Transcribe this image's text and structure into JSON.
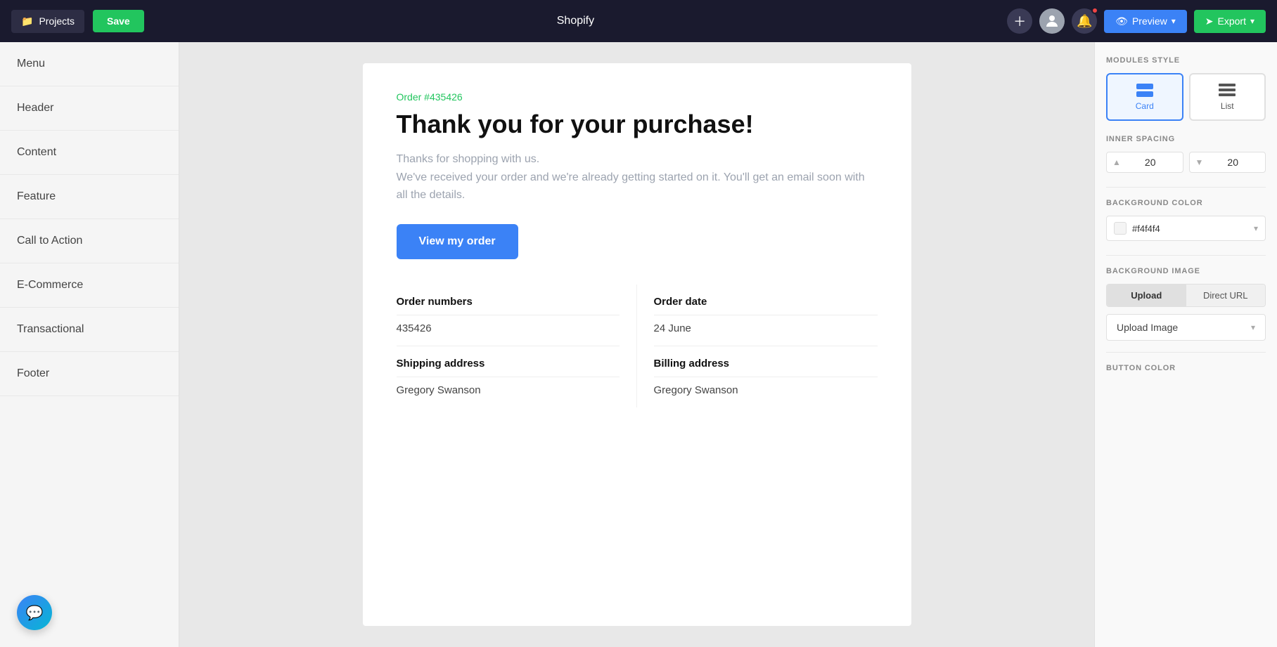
{
  "topbar": {
    "projects_label": "Projects",
    "save_label": "Save",
    "title": "Shopify",
    "preview_label": "Preview",
    "export_label": "Export"
  },
  "sidebar": {
    "items": [
      {
        "label": "Menu"
      },
      {
        "label": "Header"
      },
      {
        "label": "Content"
      },
      {
        "label": "Feature"
      },
      {
        "label": "Call to Action"
      },
      {
        "label": "E-Commerce"
      },
      {
        "label": "Transactional"
      },
      {
        "label": "Footer"
      }
    ]
  },
  "email": {
    "order_label": "Order #435426",
    "title": "Thank you for your purchase!",
    "body_line1": "Thanks for shopping with us.",
    "body_line2": "We've received your order and we're already getting started on it. You'll get an email soon with all the details.",
    "cta_button": "View my order",
    "col1_label1": "Order numbers",
    "col1_value1": "435426",
    "col1_label2": "Shipping address",
    "col1_value2": "Gregory Swanson",
    "col2_label1": "Order date",
    "col2_value1": "24 June",
    "col2_label2": "Billing address",
    "col2_value2": "Gregory Swanson"
  },
  "right_panel": {
    "modules_style_title": "MODULES STYLE",
    "card_label": "Card",
    "list_label": "List",
    "inner_spacing_title": "INNER SPACING",
    "spacing_up": "20",
    "spacing_down": "20",
    "background_color_title": "BACKGROUND COLOR",
    "bg_color": "#f4f4f4",
    "background_image_title": "BACKGROUND IMAGE",
    "upload_tab": "Upload",
    "direct_url_tab": "Direct URL",
    "upload_image_label": "Upload Image",
    "button_color_title": "BUTTON COLOR"
  }
}
